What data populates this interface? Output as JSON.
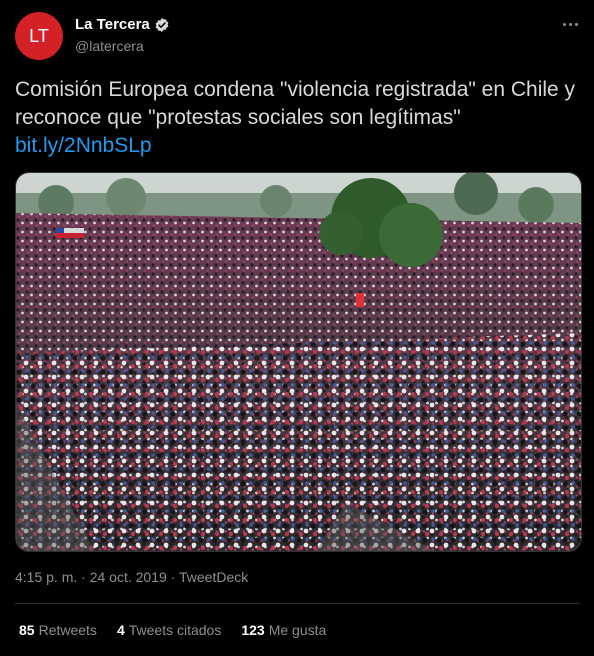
{
  "author": {
    "avatar_text": "LT",
    "avatar_color": "#d42027",
    "display_name": "La Tercera",
    "handle": "@latercera",
    "verified": true
  },
  "tweet": {
    "text": "Comisión Europea condena \"violencia registrada\" en Chile y reconoce que \"protestas sociales son legítimas\"",
    "link": "bit.ly/2NnbSLp",
    "link_color": "#1d9bf0"
  },
  "image": {
    "description_icon": "crowd-photo"
  },
  "meta": {
    "time": "4:15 p. m.",
    "date": "24 oct. 2019",
    "separator": " · ",
    "source": "TweetDeck"
  },
  "stats": {
    "retweets_count": "85",
    "retweets_label": "Retweets",
    "quotes_count": "4",
    "quotes_label": "Tweets citados",
    "likes_count": "123",
    "likes_label": "Me gusta"
  },
  "theme": {
    "background": "#000000",
    "text": "#d9d9d9",
    "secondary": "#8b8f94",
    "border": "#2f3336"
  }
}
